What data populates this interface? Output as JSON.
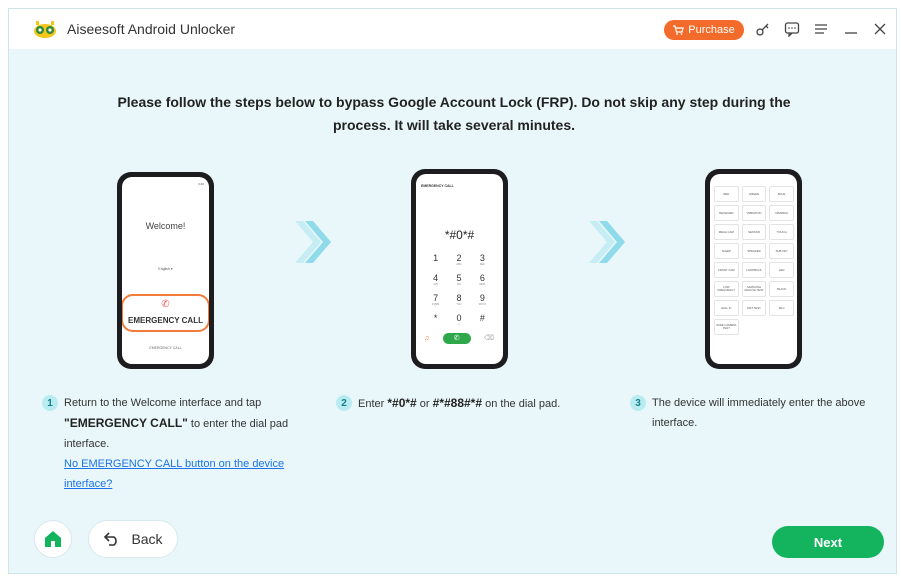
{
  "app": {
    "title": "Aiseesoft Android Unlocker",
    "purchase_label": "Purchase"
  },
  "heading": "Please follow the steps below to bypass Google Account Lock (FRP). Do not skip any step during the process. It will take several minutes.",
  "phone1": {
    "status": "3:40",
    "welcome": "Welcome!",
    "language": "English ▾",
    "emergency_call": "EMERGENCY CALL",
    "emergency_small": "EMERGENCY CALL"
  },
  "phone2": {
    "title": "EMERGENCY CALL",
    "dialed": "*#0*#",
    "keys": [
      {
        "d": "1",
        "l": ""
      },
      {
        "d": "2",
        "l": "ABC"
      },
      {
        "d": "3",
        "l": "DEF"
      },
      {
        "d": "4",
        "l": "GHI"
      },
      {
        "d": "5",
        "l": "JKL"
      },
      {
        "d": "6",
        "l": "MNO"
      },
      {
        "d": "7",
        "l": "PQRS"
      },
      {
        "d": "8",
        "l": "TUV"
      },
      {
        "d": "9",
        "l": "WXYZ"
      },
      {
        "d": "*",
        "l": ""
      },
      {
        "d": "0",
        "l": "+"
      },
      {
        "d": "#",
        "l": ""
      }
    ]
  },
  "phone3": {
    "tests": [
      "RED",
      "GREEN",
      "BLUE",
      "RECEIVER",
      "VIBRATION",
      "DIMMING",
      "MEGA CAM",
      "SENSOR",
      "TOUCH",
      "SLEEP",
      "SPEAKER",
      "SUB KEY",
      "FRONT CAM",
      "LOOPBACK",
      "LED",
      "LOW FREQUENCY",
      "SAMSUNG ANALOG TEST",
      "BLACK",
      "HALL IC",
      "MST TEST",
      "MLC",
      "WIDE CAMERA TEST"
    ]
  },
  "steps": [
    {
      "num": "1",
      "pre": "Return to the Welcome interface and tap",
      "bold": "\"EMERGENCY CALL\"",
      "post": "to enter the dial pad interface.",
      "link": "No EMERGENCY CALL button on the device interface?"
    },
    {
      "num": "2",
      "pre": "Enter",
      "code1": "*#0*#",
      "mid": "or",
      "code2": "#*#88#*#",
      "post": "on the dial pad."
    },
    {
      "num": "3",
      "text": "The device will immediately enter the above interface."
    }
  ],
  "buttons": {
    "back": "Back",
    "next": "Next"
  },
  "colors": {
    "accent_green": "#14b45f",
    "purchase_orange": "#f26b2a",
    "background": "#e9f7fb"
  }
}
